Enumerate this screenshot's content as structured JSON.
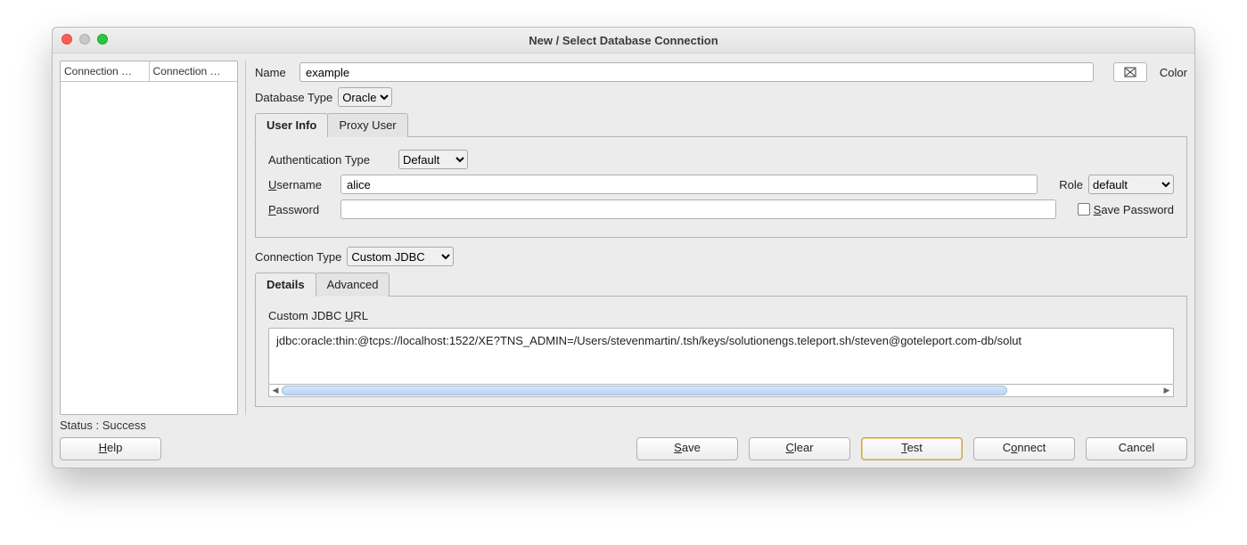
{
  "window_title": "New / Select Database Connection",
  "sidebar_headers": {
    "a": "Connection …",
    "b": "Connection …"
  },
  "name_label": "Name",
  "name_value": "example",
  "color_label": "Color",
  "dbtype_label": "Database Type",
  "dbtype_value": "Oracle",
  "tabs_ui": {
    "user_info": "User Info",
    "proxy_user": "Proxy User"
  },
  "auth_type_label": "Authentication Type",
  "auth_type_value": "Default",
  "username_label": "Username",
  "username_underline": "U",
  "username_rest": "sername",
  "username_value": "alice",
  "role_label": "Role",
  "role_value": "default",
  "password_label": "Password",
  "password_underline": "P",
  "password_rest": "assword",
  "password_value": "",
  "save_password_label": "Save Password",
  "save_password_underline": "S",
  "save_password_rest": "ave Password",
  "conn_type_label": "Connection Type",
  "conn_type_value": "Custom JDBC",
  "tabs_ct": {
    "details": "Details",
    "advanced": "Advanced"
  },
  "jdbc_label": "Custom JDBC URL",
  "jdbc_underline": "U",
  "jdbc_label_pre": "Custom JDBC ",
  "jdbc_label_post": "RL",
  "jdbc_value": "jdbc:oracle:thin:@tcps://localhost:1522/XE?TNS_ADMIN=/Users/stevenmartin/.tsh/keys/solutionengs.teleport.sh/steven@goteleport.com-db/solut",
  "status_text": "Status : Success",
  "buttons": {
    "help": "Help",
    "help_u": "H",
    "help_rest": "elp",
    "save": "Save",
    "save_u": "S",
    "save_rest": "ave",
    "clear": "Clear",
    "clear_u": "C",
    "clear_rest": "lear",
    "test": "Test",
    "test_u": "T",
    "test_rest": "est",
    "connect": "Connect",
    "connect_u": "o",
    "connect_pre": "C",
    "connect_post": "nnect",
    "cancel": "Cancel"
  }
}
